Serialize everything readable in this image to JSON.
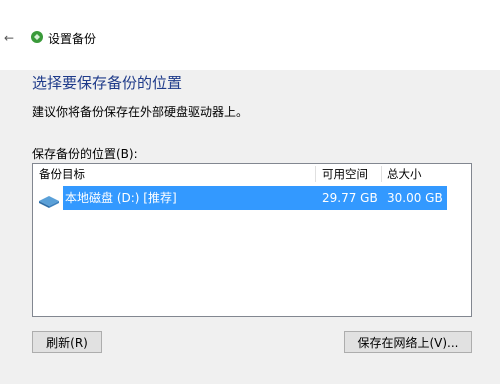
{
  "window": {
    "title": "设置备份"
  },
  "page": {
    "heading": "选择要保存备份的位置",
    "description": "建议你将备份保存在外部硬盘驱动器上。",
    "list_label": "保存备份的位置(B):"
  },
  "table": {
    "columns": [
      "备份目标",
      "可用空间",
      "总大小"
    ],
    "rows": [
      {
        "name": "本地磁盘 (D:) [推荐]",
        "free": "29.77 GB",
        "total": "30.00 GB",
        "selected": true,
        "icon": "drive-icon"
      }
    ]
  },
  "buttons": {
    "refresh": "刷新(R)",
    "save_network": "保存在网络上(V)..."
  },
  "colors": {
    "selection": "#3399ff",
    "heading": "#1f3b8a"
  }
}
